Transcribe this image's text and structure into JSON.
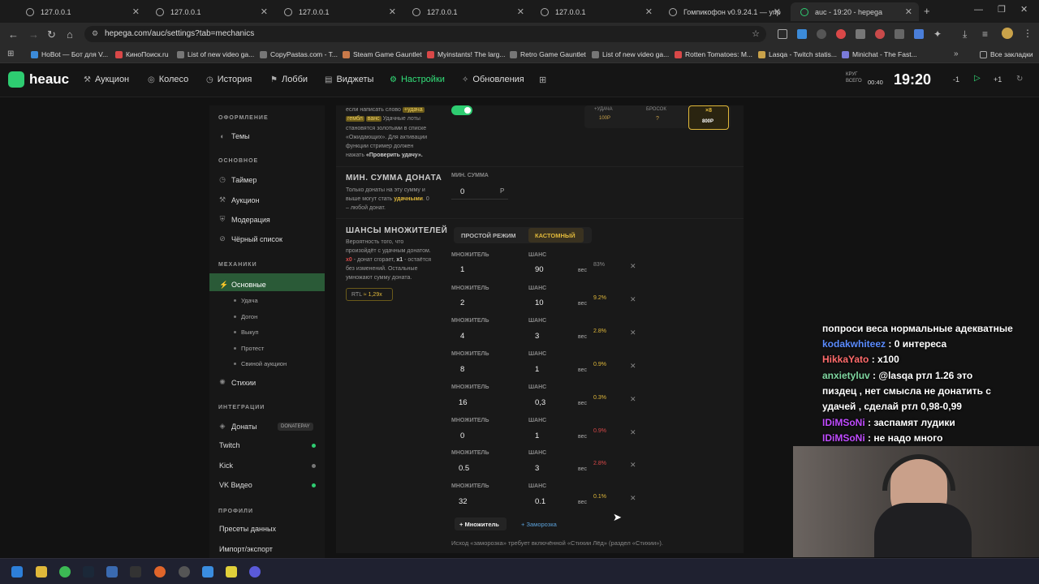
{
  "browser": {
    "tabs": [
      {
        "title": "127.0.0.1"
      },
      {
        "title": "127.0.0.1"
      },
      {
        "title": "127.0.0.1"
      },
      {
        "title": "127.0.0.1"
      },
      {
        "title": "127.0.0.1"
      },
      {
        "title": "Гомпикофон v0.9.24.1 — упр"
      },
      {
        "title": "auc - 19:20 - hepega"
      }
    ],
    "url": "hepega.com/auc/settings?tab=mechanics",
    "bookmarks": [
      "HoBot — Бот для V...",
      "КиноПоиск.ru",
      "List of new video ga...",
      "CopyPastas.com - T...",
      "Steam Game Gauntlet",
      "Myinstants! The larg...",
      "Retro Game Gauntlet",
      "List of new video ga...",
      "Rotten Tomatoes: M...",
      "Lasqa - Twitch statis...",
      "Minichat - The Fast..."
    ],
    "all_bookmarks": "Все закладки"
  },
  "app": {
    "logo": "heauc",
    "nav": [
      {
        "label": "Аукцион",
        "icon": "gavel-icon"
      },
      {
        "label": "Колесо",
        "icon": "wheel-icon"
      },
      {
        "label": "История",
        "icon": "history-icon"
      },
      {
        "label": "Лобби",
        "icon": "lobby-icon"
      },
      {
        "label": "Виджеты",
        "icon": "widget-icon"
      },
      {
        "label": "Настройки",
        "icon": "gear-icon"
      },
      {
        "label": "Обновления",
        "icon": "updates-icon"
      }
    ],
    "round_label": "КРУГ",
    "total_label": "ВСЕГО",
    "total_value": "00:40",
    "timer": "19:20",
    "minus": "-1",
    "plus": "+1"
  },
  "sidebar": {
    "sections": {
      "design": "ОФОРМЛЕНИЕ",
      "basic": "ОСНОВНОЕ",
      "mechanics": "МЕХАНИКИ",
      "integrations": "ИНТЕГРАЦИИ",
      "profiles": "ПРОФИЛИ"
    },
    "themes": "Темы",
    "timer": "Таймер",
    "auction": "Аукцион",
    "moderation": "Модерация",
    "blacklist": "Чёрный список",
    "basic": "Основные",
    "subs": [
      "Удача",
      "Догон",
      "Выкуп",
      "Протест",
      "Свиной аукцион"
    ],
    "elements": "Стихии",
    "donations": "Донаты",
    "donatepay": "DONATEPAY",
    "twitch": "Twitch",
    "kick": "Kick",
    "vk": "VK Видео",
    "presets": "Пресеты данных",
    "import": "Импорт/экспорт",
    "colors": {
      "twitch": "#2ecc71",
      "kick": "#777777",
      "vk": "#2ecc71"
    }
  },
  "main": {
    "top_text_1": "если написать слово",
    "top_tag_1": "+удача",
    "top_tag_2": "гембл",
    "top_tag_3": "ванс",
    "top_text_2": "Удачные лоты",
    "top_text_3": "становятся золотыми в списке",
    "top_text_4": "«Ожидающих». Для активации",
    "top_text_5": "функции стример должен",
    "top_text_6": "нажать",
    "top_text_7": "«Проверить удачу».",
    "preview_1_label": "+УДАЧА",
    "preview_1_value": "100Р",
    "preview_2_label": "БРОСОК",
    "preview_2_value": "?",
    "preview_3_label": "×8",
    "preview_3_value": "800Р",
    "min_sum": {
      "title": "МИН. СУММА ДОНАТА",
      "desc_1": "Только донаты на эту сумму и",
      "desc_2": "выше могут стать",
      "desc_hl": "удачными",
      "desc_3": ". 0",
      "desc_4": "– любой донат.",
      "field_label": "МИН. СУММА",
      "value": "0",
      "currency": "Р"
    },
    "multipliers": {
      "title": "ШАНСЫ МНОЖИТЕЛЕЙ",
      "desc_1": "Вероятность того, что",
      "desc_2": "произойдёт с удачным донатом.",
      "desc_3a": "х0",
      "desc_3b": "- донат сгорает,",
      "desc_3c": "х1",
      "desc_3d": "- остаётся",
      "desc_4": "без изменений. Остальные",
      "desc_5": "умножают сумму доната.",
      "rtl_label": "RTL",
      "rtl_value": "≈ 1,29x",
      "mode_simple": "ПРОСТОЙ РЕЖИМ",
      "mode_custom": "КАСТОМНЫЙ",
      "col_mult": "МНОЖИТЕЛЬ",
      "col_chance": "ШАНС",
      "weight": "вес",
      "rows": [
        {
          "mult": "1",
          "chance": "90",
          "pct": "83%",
          "color": "#8a8a8a"
        },
        {
          "mult": "2",
          "chance": "10",
          "pct": "9.2%",
          "color": "#e0b83a"
        },
        {
          "mult": "4",
          "chance": "3",
          "pct": "2.8%",
          "color": "#e0b83a"
        },
        {
          "mult": "8",
          "chance": "1",
          "pct": "0.9%",
          "color": "#e0b83a"
        },
        {
          "mult": "16",
          "chance": "0,3",
          "pct": "0.3%",
          "color": "#e0b83a"
        },
        {
          "mult": "0",
          "chance": "1",
          "pct": "0.9%",
          "color": "#d94848"
        },
        {
          "mult": "0.5",
          "chance": "3",
          "pct": "2.8%",
          "color": "#d94848"
        },
        {
          "mult": "32",
          "chance": "0.1",
          "pct": "0.1%",
          "color": "#e0b83a"
        }
      ],
      "add_mult": "+ Множитель",
      "add_freeze": "+ Заморозка",
      "footer": "Исход «заморозка» требует включённой «Стихии Лёд» (раздел «Стихии»)."
    }
  },
  "chat": [
    {
      "user": "",
      "text": "попроси веса нормальные адекватные",
      "color": "#ffffff"
    },
    {
      "user": "kodakwhiteez",
      "text": "0 интереса",
      "color": "#5b8cff"
    },
    {
      "user": "HikkaYato",
      "text": "x100",
      "color": "#ff6b6b"
    },
    {
      "user": "anxietyluv",
      "text": "@lasqa ртл 1.26 это",
      "color": "#7fd6a0"
    },
    {
      "user": "",
      "text": "пиздец , нет смысла не донатить с",
      "color": "#ffffff"
    },
    {
      "user": "",
      "text": "удачей , сделай ртл 0,98-0,99",
      "color": "#ffffff"
    },
    {
      "user": "IDiMSoNi",
      "text": "заспамят лудики",
      "color": "#c04bff"
    },
    {
      "user": "IDiMSoNi",
      "text": "не надо много",
      "color": "#c04bff"
    }
  ]
}
